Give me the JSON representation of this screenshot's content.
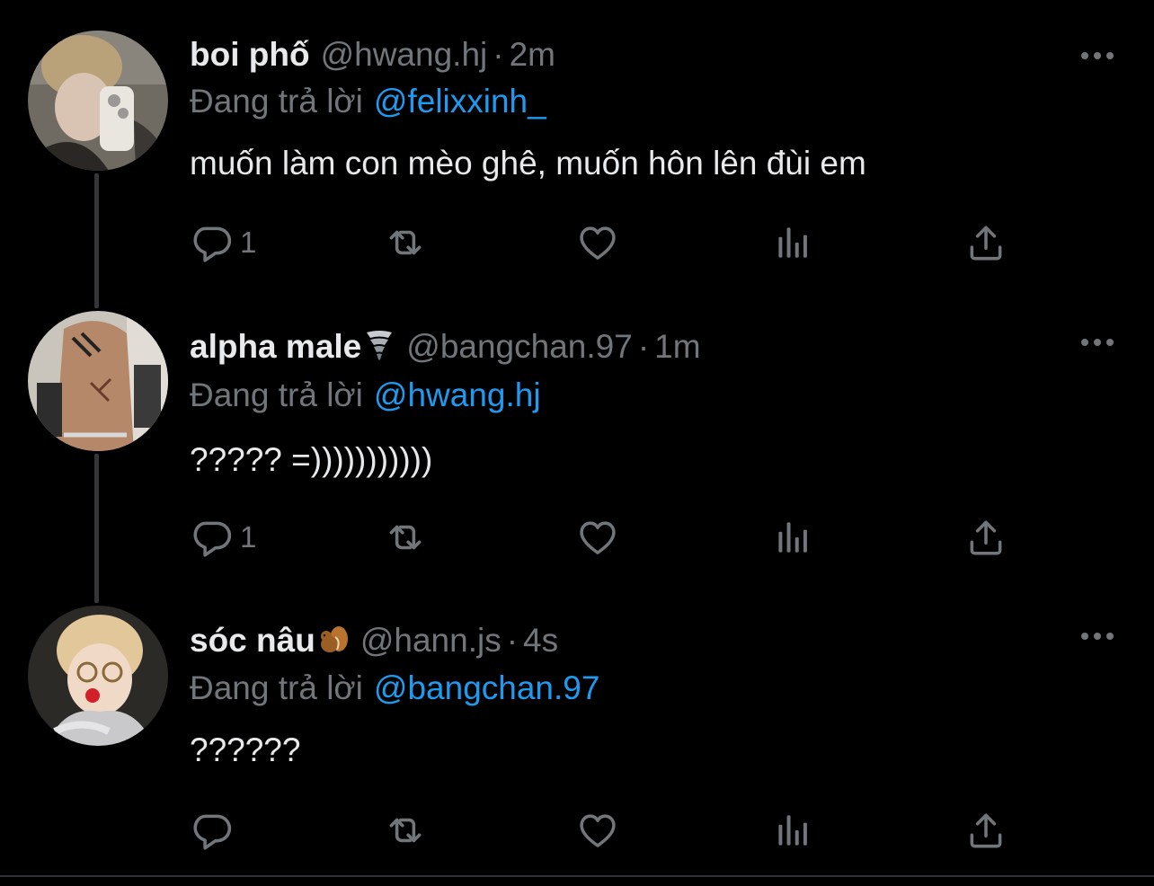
{
  "colors": {
    "background": "#000000",
    "text_primary": "#e7e9ea",
    "text_secondary": "#71767b",
    "link": "#1d9bf0",
    "thread_line": "#333639"
  },
  "labels": {
    "replying_to": "Đang trả lời",
    "dot": "·"
  },
  "tweets": [
    {
      "display_name": "boi phố",
      "emoji": "",
      "handle": "@hwang.hj",
      "time": "2m",
      "reply_to": "@felixxinh_",
      "text": "muốn làm con mèo ghê, muốn hôn lên đùi em",
      "reply_count": "1",
      "avatar_icon": "avatar-photo"
    },
    {
      "display_name": "alpha male",
      "emoji": "tornado-emoji",
      "handle": "@bangchan.97",
      "time": "1m",
      "reply_to": "@hwang.hj",
      "text": "????? =)))))))))))",
      "reply_count": "1",
      "avatar_icon": "avatar-photo"
    },
    {
      "display_name": "sóc nâu",
      "emoji": "chipmunk-emoji",
      "handle": "@hann.js",
      "time": "4s",
      "reply_to": "@bangchan.97",
      "text": "??????",
      "reply_count": "",
      "avatar_icon": "avatar-photo"
    }
  ],
  "action_icons": [
    "reply-icon",
    "retweet-icon",
    "like-icon",
    "views-icon",
    "share-icon"
  ]
}
